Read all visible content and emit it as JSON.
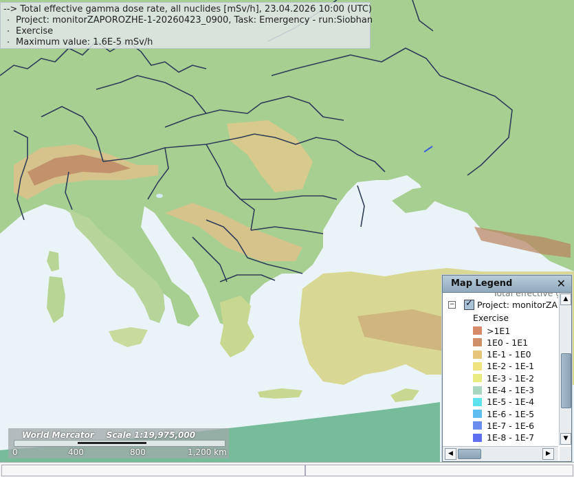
{
  "info": {
    "line1": "--> Total effective gamma dose rate, all nuclides [mSv/h], 23.04.2026 10:00 (UTC)",
    "line2": "Project: monitorZAPOROZHE-1-20260423_0900, Task: Emergency - run:Siobhan",
    "line3": "Exercise",
    "line4": "Maximum value: 1.6E-5 mSv/h"
  },
  "scalebar": {
    "projection": "World Mercator",
    "scale": "Scale 1:19,975,000",
    "ticks": [
      "0",
      "400",
      "800",
      "1,200 km"
    ]
  },
  "legend": {
    "title": "Map Legend",
    "clipped_text": "Total effective gam",
    "project_label": "Project: monitorZAP",
    "exercise_label": "Exercise",
    "items": [
      {
        "label": ">1E1",
        "color": "#d68a6a"
      },
      {
        "label": "1E0 - 1E1",
        "color": "#cf8f68"
      },
      {
        "label": "1E-1 - 1E0",
        "color": "#e6c47a"
      },
      {
        "label": "1E-2 - 1E-1",
        "color": "#eee37e"
      },
      {
        "label": "1E-3 - 1E-2",
        "color": "#e9ea80"
      },
      {
        "label": "1E-4 - 1E-3",
        "color": "#a9d6c0"
      },
      {
        "label": "1E-5 - 1E-4",
        "color": "#5ee3ee"
      },
      {
        "label": "1E-6 - 1E-5",
        "color": "#5fbdf0"
      },
      {
        "label": "1E-7 - 1E-6",
        "color": "#6a8cee"
      },
      {
        "label": "1E-8 - 1E-7",
        "color": "#5e6ff0"
      }
    ]
  },
  "colors": {
    "sea": "#eaf4f8",
    "lowland": "#a8cf92",
    "highland": "#e7dd9a",
    "mountain": "#b98260",
    "border": "#2d3c57",
    "plume": "#3b63d8"
  },
  "icons": [
    "close-icon",
    "collapse-icon",
    "checkbox-checked-icon",
    "scroll-up-icon",
    "scroll-down-icon",
    "scroll-left-icon",
    "scroll-right-icon"
  ]
}
